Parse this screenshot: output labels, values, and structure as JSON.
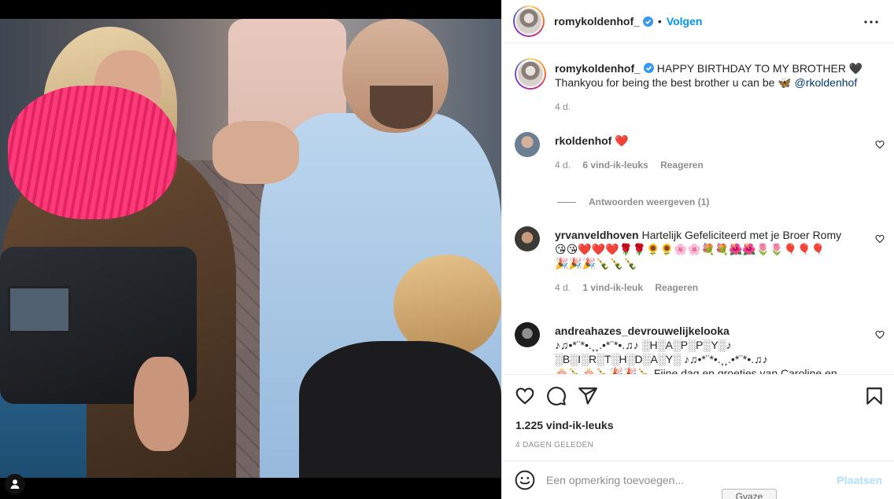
{
  "post": {
    "author": "romykoldenhof_",
    "follow_label": "Volgen",
    "dot": "•",
    "caption_text": "HAPPY BIRTHDAY TO MY BROTHER 🖤",
    "caption_line2": "Thankyou for being the best brother u can be 🦋",
    "caption_mention": "@rkoldenhof",
    "caption_time": "4 d."
  },
  "comments": [
    {
      "username": "rkoldenhof",
      "text": "❤️",
      "time": "4 d.",
      "likes": "6 vind-ik-leuks",
      "reply": "Reageren"
    },
    {
      "username": "yrvanveldhoven",
      "text": "Hartelijk Gefeliciteerd met je Broer Romy",
      "text2": "😘😘❤️❤️❤️🌹🌹🌻🌻🌸🌸💐💐🌺🌺🌷🌷🎈🎈🎈",
      "text3": "🎉🎉🎉🍾🍾🍾",
      "time": "4 d.",
      "likes": "1 vind-ik-leuk",
      "reply": "Reageren"
    },
    {
      "username": "andreahazes_devrouwelijkelooka",
      "text": "♪♫•*¨*•.¸¸.•*¨*•.♫♪ ░H░A░P░P░Y░♪",
      "text2": "░B░I░R░T░H░D░A░Y░ ♪♫•*¨*•.¸¸.•*¨*•.♫♪",
      "text3": "🎂🍾🎂🍾🎉🎉🍾 Fijne dag en groetjes van Caroline en"
    }
  ],
  "replies_label": "Antwoorden weergeven (1)",
  "likes_count": "1.225 vind-ik-leuks",
  "posted_ago": "4 DAGEN GELEDEN",
  "comment_input": {
    "placeholder": "Een opmerking toevoegen...",
    "post_label": "Plaatsen"
  },
  "tooltip": "Gvaze",
  "icons": {
    "tag": "user-tag-icon",
    "more": "more-options-icon",
    "verified": "verified-badge-icon",
    "like": "heart-icon",
    "comment": "comment-icon",
    "share": "share-icon",
    "save": "bookmark-icon",
    "emoji": "emoji-icon"
  },
  "colors": {
    "accent": "#0095f6",
    "post_disabled": "#b2dffc",
    "muted": "#8e8e8e",
    "mention": "#00376b"
  }
}
